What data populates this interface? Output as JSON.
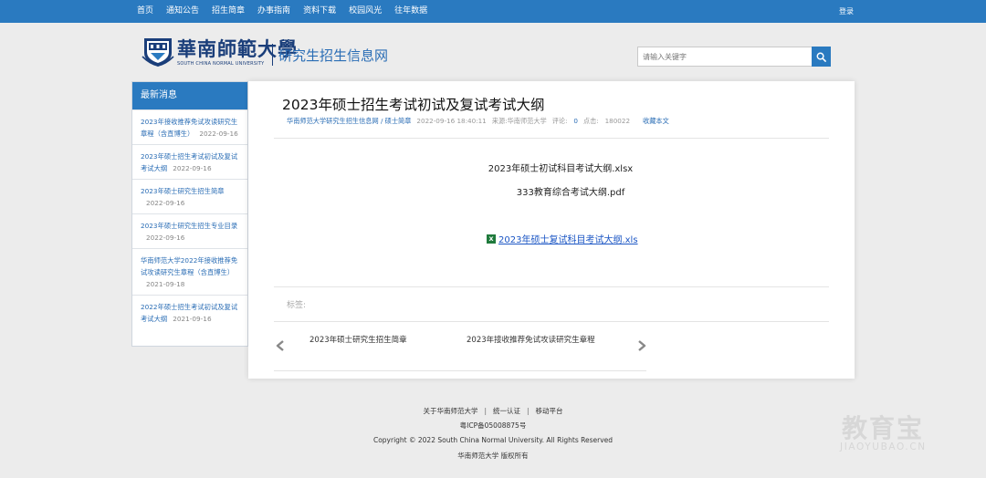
{
  "nav": {
    "items": [
      "首页",
      "通知公告",
      "招生简章",
      "办事指南",
      "资料下载",
      "校园风光",
      "往年数据"
    ],
    "login": "登录"
  },
  "header": {
    "logo_cn": "華南師範大學",
    "logo_en": "SOUTH CHINA NORMAL UNIVERSITY",
    "site_title": "研究生招生信息网"
  },
  "search": {
    "placeholder": "请输入关键字",
    "button_icon": "search-icon"
  },
  "sidebar": {
    "heading": "最新消息",
    "items": [
      {
        "title": "2023年接收推荐免试攻读研究生章程（含直博生）",
        "date": "2022-09-16"
      },
      {
        "title": "2023年硕士招生考试初试及复试考试大纲",
        "date": "2022-09-16"
      },
      {
        "title": "2023年硕士研究生招生简章",
        "date": "2022-09-16"
      },
      {
        "title": "2023年硕士研究生招生专业目录",
        "date": "2022-09-16"
      },
      {
        "title": "华南师范大学2022年接收推荐免试攻读研究生章程（含直博生）",
        "date": "2021-09-18"
      },
      {
        "title": "2022年硕士招生考试初试及复试考试大纲",
        "date": "2021-09-16"
      }
    ]
  },
  "article": {
    "title": "2023年硕士招生考试初试及复试考试大纲",
    "breadcrumb_site": "华南师范大学研究生招生信息网",
    "breadcrumb_sep": "/",
    "breadcrumb_section": "硕士简章",
    "datetime": "2022-09-16 18:40:11",
    "source_label": "来源:",
    "source": "华南师范大学",
    "comments_label": "评论:",
    "comments": "0",
    "views_label": "点击:",
    "views": "180022",
    "favorite": "收藏本文",
    "file1": "2023年硕士初试科目考试大纲.xlsx",
    "file2": "333教育综合考试大纲.pdf",
    "attachment": "2023年硕士复试科目考试大纲.xls",
    "attachment_icon": "excel-icon",
    "tags_label": "标签:",
    "prev": "2023年硕士研究生招生简章",
    "next": "2023年接收推荐免试攻读研究生章程"
  },
  "footer": {
    "about": "关于华南师范大学",
    "sso": "统一认证",
    "mobile": "移动平台",
    "divider": "|",
    "icp": "粤ICP备05008875号",
    "copyright": "Copyright © 2022 South China Normal University. All Rights Reserved",
    "rights": "华南师范大学 版权所有"
  },
  "watermark": {
    "cn": "教育宝",
    "en": "JIAOYUBAO.CN"
  },
  "colors": {
    "nav_bg": "#2a7ac0",
    "link": "#2a6db5",
    "brand": "#1a3e7a",
    "page_bg": "#ececec"
  }
}
